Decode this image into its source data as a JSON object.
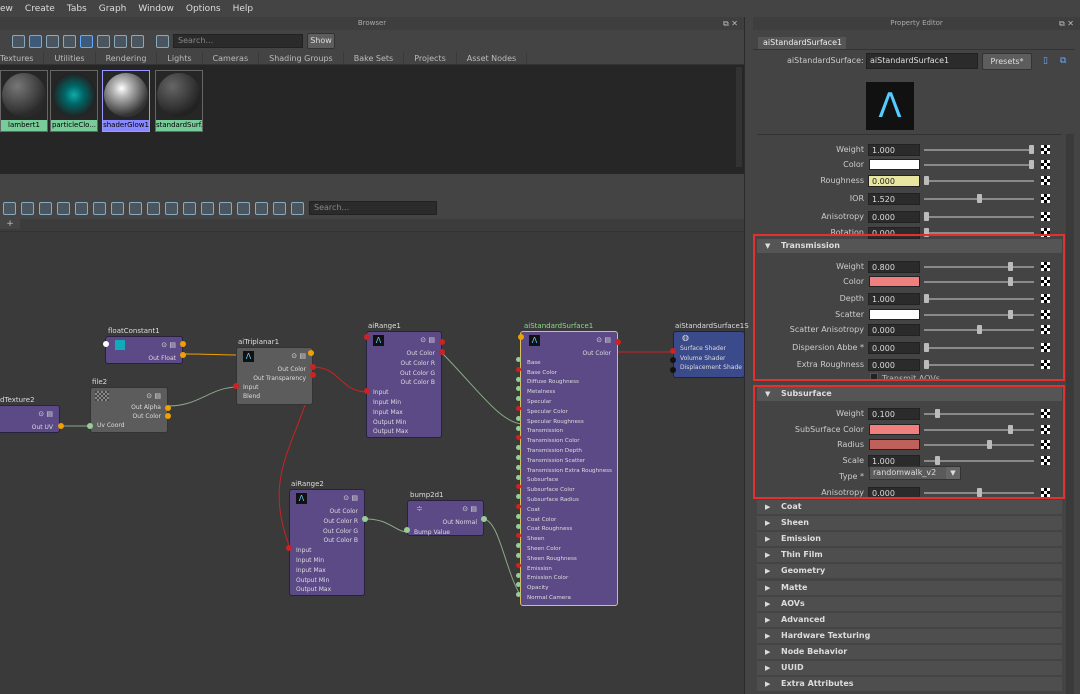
{
  "menu": [
    "ew",
    "Create",
    "Tabs",
    "Graph",
    "Window",
    "Options",
    "Help"
  ],
  "browser": {
    "title": "Browser",
    "search_placeholder": "Search...",
    "show_label": "Show",
    "tabs": [
      "Textures",
      "Utilities",
      "Rendering",
      "Lights",
      "Cameras",
      "Shading Groups",
      "Bake Sets",
      "Projects",
      "Asset Nodes"
    ],
    "swatches": [
      "lambert1",
      "particleClo...",
      "shaderGlow1",
      "standardSurf..."
    ]
  },
  "node_editor": {
    "search_placeholder": "Search...",
    "tab_add": "+",
    "nodes": {
      "floatConstant1": {
        "title": "floatConstant1",
        "rows": [
          "Out Float"
        ]
      },
      "file2": {
        "title": "file2",
        "rows": [
          "Out Alpha",
          "Out Color",
          "Uv Coord"
        ]
      },
      "dTexture2": {
        "title": "dTexture2",
        "rows": [
          "Out UV"
        ]
      },
      "aiTriplanar1": {
        "title": "aiTriplanar1",
        "rows": [
          "Out Color",
          "Out Transparency",
          "Input",
          "Blend"
        ]
      },
      "aiRange1": {
        "title": "aiRange1",
        "rows": [
          "Out Color",
          "Out Color R",
          "Out Color G",
          "Out Color B",
          "Input",
          "Input Min",
          "Input Max",
          "Output Min",
          "Output Max"
        ]
      },
      "aiRange2": {
        "title": "aiRange2",
        "rows": [
          "Out Color",
          "Out Color R",
          "Out Color G",
          "Out Color B",
          "Input",
          "Input Min",
          "Input Max",
          "Output Min",
          "Output Max"
        ]
      },
      "bump2d1": {
        "title": "bump2d1",
        "rows": [
          "Out Normal",
          "Bump Value"
        ]
      },
      "aiStandardSurface1": {
        "title": "aiStandardSurface1",
        "rows": [
          "Out Color",
          "Base",
          "Base Color",
          "Diffuse Roughness",
          "Metalness",
          "Specular",
          "Specular Color",
          "Specular Roughness",
          "Transmission",
          "Transmission Color",
          "Transmission Depth",
          "Transmission Scatter",
          "Transmission Extra Roughness",
          "Subsurface",
          "Subsurface Color",
          "Subsurface Radius",
          "Coat",
          "Coat Color",
          "Coat Roughness",
          "Sheen",
          "Sheen Color",
          "Sheen Roughness",
          "Emission",
          "Emission Color",
          "Opacity",
          "Normal Camera"
        ]
      },
      "aiStandardSurface1SG": {
        "title": "aiStandardSurface1S",
        "rows": [
          "Surface Shader",
          "Volume Shader",
          "Displacement Shade"
        ]
      }
    }
  },
  "property_editor": {
    "title": "Property Editor",
    "tab": "aiStandardSurface1",
    "shader_label": "aiStandardSurface:",
    "shader_name": "aiStandardSurface1",
    "presets": "Presets*",
    "top_rows": [
      {
        "label": "Weight",
        "value": "1.000",
        "slider": 1.0
      },
      {
        "label": "Color",
        "swatch": "#ffffff",
        "slider": 1.0
      },
      {
        "label": "Roughness",
        "value": "0.000",
        "slider": 0.0
      },
      {
        "label": "IOR",
        "value": "1.520",
        "slider": 0.5
      },
      {
        "label": "Anisotropy",
        "value": "0.000",
        "slider": 0.0
      },
      {
        "label": "Rotation",
        "value": "0.000",
        "slider": 0.0
      }
    ],
    "transmission": {
      "header": "Transmission",
      "rows": [
        {
          "label": "Weight",
          "value": "0.800",
          "slider": 0.8
        },
        {
          "label": "Color",
          "swatch": "#f08080",
          "slider": 0.8
        },
        {
          "label": "Depth",
          "value": "1.000",
          "slider": 0.0
        },
        {
          "label": "Scatter",
          "swatch": "#ffffff",
          "slider": 0.8
        },
        {
          "label": "Scatter Anisotropy",
          "value": "0.000",
          "slider": 0.5
        },
        {
          "label": "Dispersion Abbe *",
          "value": "0.000",
          "slider": 0.0
        },
        {
          "label": "Extra Roughness",
          "value": "0.000",
          "slider": 0.0
        }
      ],
      "transmit_aovs": "Transmit AOVs"
    },
    "subsurface": {
      "header": "Subsurface",
      "rows": [
        {
          "label": "Weight",
          "value": "0.100",
          "slider": 0.1
        },
        {
          "label": "SubSurface Color",
          "swatch": "#f08080",
          "slider": 0.8
        },
        {
          "label": "Radius",
          "swatch": "#c0605a",
          "slider": 0.6
        },
        {
          "label": "Scale",
          "value": "1.000",
          "slider": 0.1
        },
        {
          "label": "Anisotropy",
          "value": "0.000",
          "slider": 0.5
        }
      ],
      "type_label": "Type *",
      "type_value": "randomwalk_v2"
    },
    "collapsed": [
      "Coat",
      "Sheen",
      "Emission",
      "Thin Film",
      "Geometry",
      "Matte",
      "AOVs",
      "Advanced",
      "Hardware Texturing",
      "Node Behavior",
      "UUID",
      "Extra Attributes"
    ]
  },
  "colors": {
    "highlight": "#e53030",
    "node_purple": "#5b4a86",
    "swatch_green": "#77cc99"
  }
}
